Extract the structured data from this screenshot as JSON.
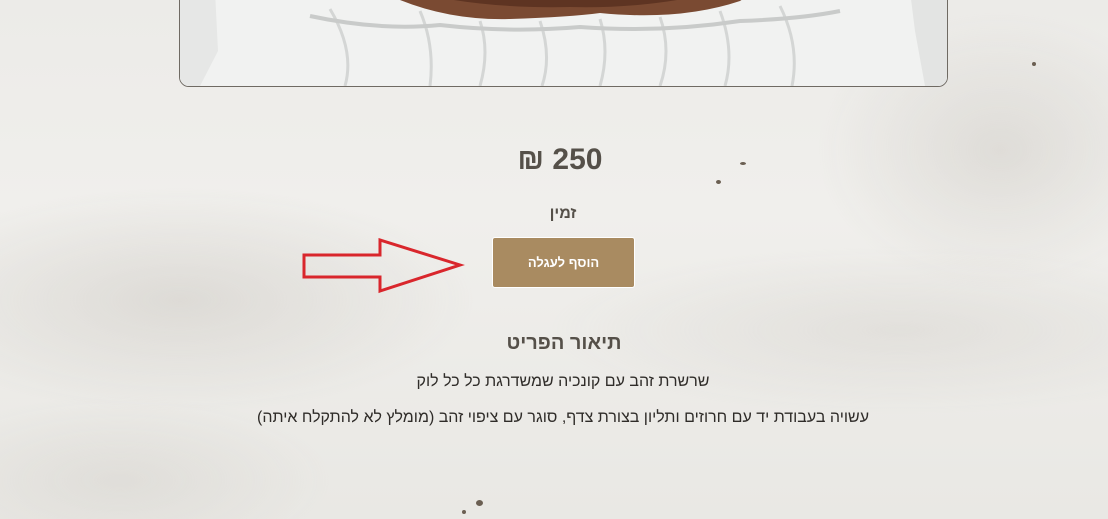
{
  "product": {
    "price": "250 ₪",
    "stock_status": "זמין",
    "add_to_cart_label": "הוסף לעגלה"
  },
  "description": {
    "title": "תיאור הפריט",
    "lines": [
      "שרשרת זהב עם קונכיה שמשדרגת כל כל לוק",
      "עשויה בעבודת יד עם חרוזים ותליון בצורת צדף, סוגר עם ציפוי זהב (מומלץ לא להתקלח איתה)"
    ]
  },
  "colors": {
    "accent_button": "#a98b61",
    "text_heading": "#555049",
    "annotation_arrow": "#d9262c"
  }
}
